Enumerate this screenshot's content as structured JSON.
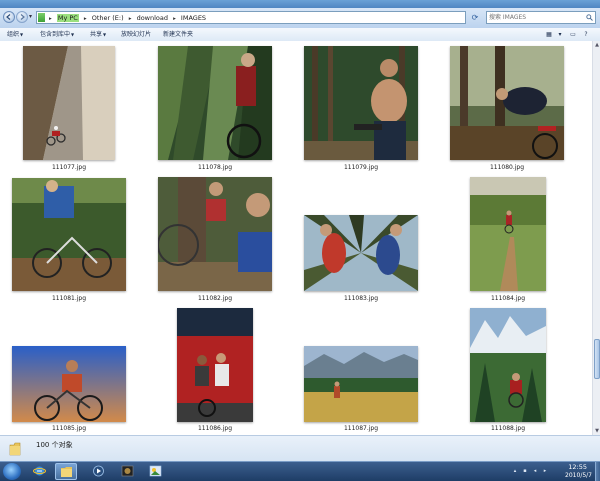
{
  "window": {
    "breadcrumbs": [
      "My PC",
      "Other (E:)",
      "download",
      "IMAGES"
    ],
    "search_placeholder": "搜索 IMAGES"
  },
  "toolbar": {
    "organize": "组织",
    "include_in_library": "包含到库中",
    "share": "共享",
    "slideshow": "放映幻灯片",
    "new_folder": "新建文件夹"
  },
  "files": [
    {
      "name": "111077.jpg",
      "scene": "road-cyclist"
    },
    {
      "name": "111078.jpg",
      "scene": "motion-rider"
    },
    {
      "name": "111079.jpg",
      "scene": "shirtless-rider"
    },
    {
      "name": "111080.jpg",
      "scene": "forest-crash"
    },
    {
      "name": "111081.jpg",
      "scene": "speed-blur"
    },
    {
      "name": "111082.jpg",
      "scene": "riders-rest"
    },
    {
      "name": "111083.jpg",
      "scene": "low-angle-trees"
    },
    {
      "name": "111084.jpg",
      "scene": "trail-rider"
    },
    {
      "name": "111085.jpg",
      "scene": "sky-rider"
    },
    {
      "name": "111086.jpg",
      "scene": "train-wall"
    },
    {
      "name": "111087.jpg",
      "scene": "meadow-hiker"
    },
    {
      "name": "111088.jpg",
      "scene": "mountain-rider"
    }
  ],
  "status": {
    "item_count": "100 个对象"
  },
  "taskbar": {
    "time": "12:55",
    "date": "2010/5/7"
  },
  "colors": {
    "title_bar": "#4f86c2",
    "taskbar": "#1e3d66",
    "address_highlight": "#9be07e"
  }
}
